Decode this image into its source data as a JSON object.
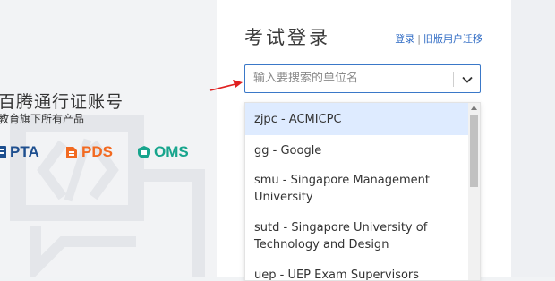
{
  "left": {
    "title": "百腾通行证账号",
    "subtitle": "教育旗下所有产品",
    "logos": [
      {
        "name": "PTA",
        "color": "#1e4f8f"
      },
      {
        "name": "PDS",
        "color": "#f26a21"
      },
      {
        "name": "OMS",
        "color": "#18a58d"
      }
    ]
  },
  "login": {
    "title": "考试登录",
    "links": {
      "login": "登录",
      "separator": "|",
      "migrate": "旧版用户迁移"
    },
    "search": {
      "placeholder": "输入要搜索的单位名",
      "value": ""
    },
    "options": [
      "zjpc - ACMICPC",
      "gg - Google",
      "smu - Singapore Management University",
      "sutd - Singapore University of Technology and Design",
      "uep - UEP Exam Supervisors"
    ]
  },
  "colors": {
    "accent": "#3a78c8",
    "selected_option": "#deebff",
    "arrow": "#e02020"
  }
}
